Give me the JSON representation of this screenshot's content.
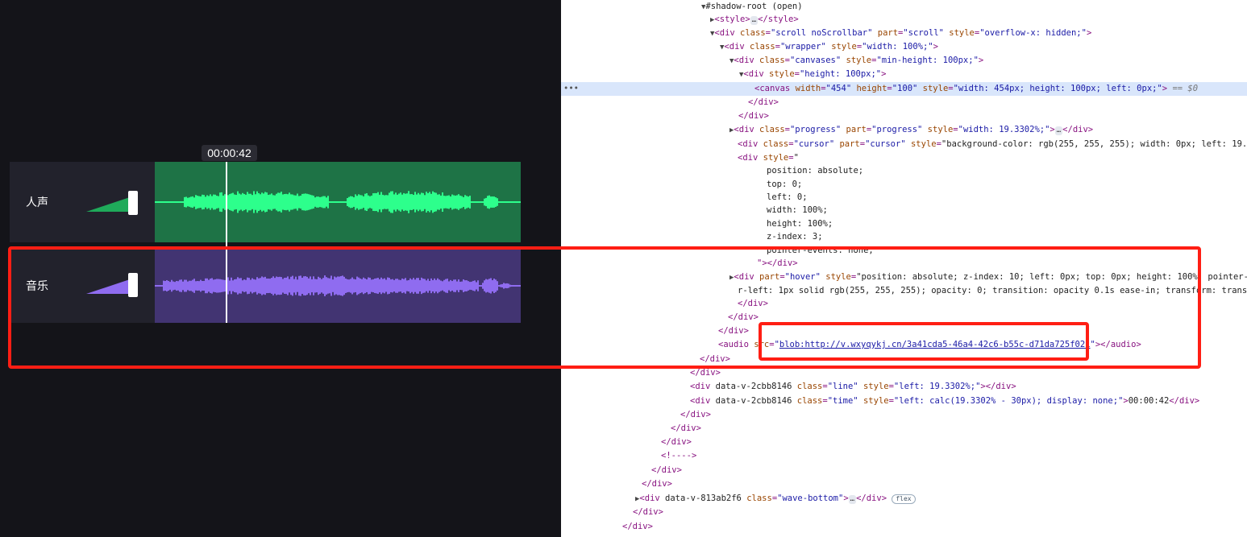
{
  "player": {
    "current_time": "00:00:42",
    "tracks": [
      {
        "name": "人声",
        "wave_color": "#2dff8c",
        "bg_color": "#1e7346",
        "vol_color": "#1faa5a"
      },
      {
        "name": "音乐",
        "wave_color": "#8f6cf0",
        "bg_color": "#423472",
        "vol_color": "#8f6cf0"
      }
    ],
    "progress_percent": 19.3302
  },
  "devtools": {
    "lines": [
      [
        "▼",
        "#shadow-root (open)"
      ],
      [
        "▶",
        "<style>",
        "…",
        "</style>"
      ],
      [
        "▼",
        "<div class=\"scroll noScrollbar\" part=\"scroll\" style=\"overflow-x: hidden;\">"
      ],
      [
        "▼",
        "<div class=\"wrapper\" style=\"width: 100%;\">"
      ],
      [
        "▼",
        "<div class=\"canvases\" style=\"min-height: 100px;\">"
      ],
      [
        "▼",
        "<div style=\"height: 100px;\">"
      ],
      [
        "",
        "<canvas width=\"454\" height=\"100\" style=\"width: 454px; height: 100px; left: 0px;\"> == $0"
      ],
      [
        "",
        "</div>"
      ],
      [
        "",
        "</div>"
      ],
      [
        "▶",
        "<div class=\"progress\" part=\"progress\" style=\"width: 19.3302%;\">",
        "…",
        "</div>"
      ],
      [
        "",
        "<div class=\"cursor\" part=\"cursor\" style=\"background-color: rgb(255, 255, 255); width: 0px; left: 19.3302%"
      ],
      [
        "",
        "<div style=\""
      ],
      [
        "",
        "position: absolute;"
      ],
      [
        "",
        "top: 0;"
      ],
      [
        "",
        "left: 0;"
      ],
      [
        "",
        "width: 100%;"
      ],
      [
        "",
        "height: 100%;"
      ],
      [
        "",
        "z-index: 3;"
      ],
      [
        "",
        "pointer-events: none;"
      ],
      [
        "",
        "\"></div>"
      ],
      [
        "▶",
        "<div part=\"hover\" style=\"position: absolute; z-index: 10; left: 0px; top: 0px; height: 100%; pointer-even"
      ],
      [
        "",
        "r-left: 1px solid rgb(255, 255, 255); opacity: 0; transition: opacity 0.1s ease-in; transform: translateX"
      ],
      [
        "",
        "</div>"
      ],
      [
        "",
        "</div>"
      ],
      [
        "",
        "</div>"
      ],
      [
        "",
        "<audio src=\"blob:http://v.wxyqykj.cn/3a41cda5-46a4-42c6-b55c-d71da725f021\"></audio>"
      ],
      [
        "",
        "</div>"
      ],
      [
        "",
        "</div>"
      ],
      [
        "",
        "<div data-v-2cbb8146 class=\"line\" style=\"left: 19.3302%;\"></div>"
      ],
      [
        "",
        "<div data-v-2cbb8146 class=\"time\" style=\"left: calc(19.3302% - 30px); display: none;\">00:00:42</div>"
      ],
      [
        "",
        "</div>"
      ],
      [
        "",
        "</div>"
      ],
      [
        "",
        "</div>"
      ],
      [
        "",
        "<!---->"
      ],
      [
        "",
        "</div>"
      ],
      [
        "",
        "</div>"
      ],
      [
        "▶",
        "<div data-v-813ab2f6 class=\"wave-bottom\">",
        "…",
        "</div>",
        "flex"
      ],
      [
        "",
        "</div>"
      ],
      [
        "",
        "</div>"
      ]
    ],
    "selected_marker": "== $0",
    "audio_src": "blob:http://v.wxyqykj.cn/3a41cda5-46a4-42c6-b55c-d71da725f021"
  }
}
